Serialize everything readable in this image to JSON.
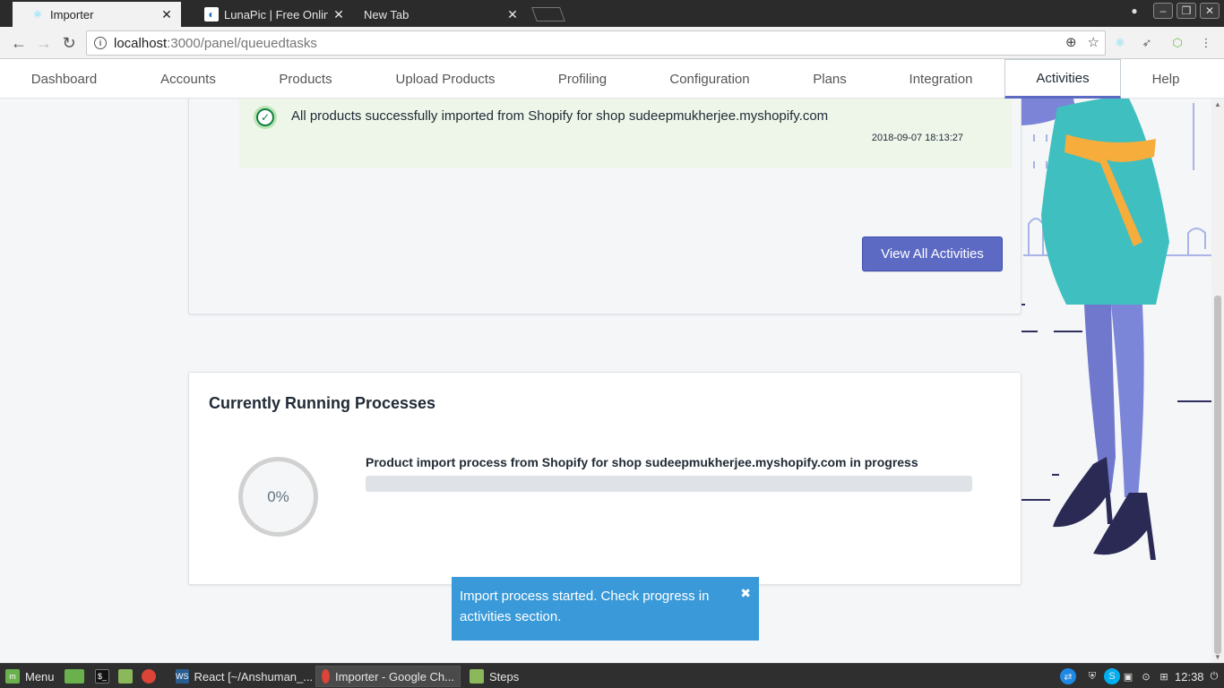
{
  "browser": {
    "tabs": [
      {
        "title": "Importer",
        "icon": "react-icon",
        "active": true
      },
      {
        "title": "LunaPic | Free Online Photo Editor",
        "icon": "lunapic-icon",
        "active": false
      },
      {
        "title": "New Tab",
        "icon": "",
        "active": false
      }
    ],
    "url_host": "localhost",
    "url_path": ":3000/panel/queuedtasks"
  },
  "nav": {
    "items": [
      {
        "label": "Dashboard"
      },
      {
        "label": "Accounts"
      },
      {
        "label": "Products"
      },
      {
        "label": "Upload Products"
      },
      {
        "label": "Profiling"
      },
      {
        "label": "Configuration"
      },
      {
        "label": "Plans"
      },
      {
        "label": "Integration"
      },
      {
        "label": "Activities"
      },
      {
        "label": "Help"
      }
    ],
    "active": "Activities"
  },
  "activity": {
    "message": "All products successfully imported from Shopify for shop sudeepmukherjee.myshopify.com",
    "timestamp": "2018-09-07 18:13:27",
    "view_all_label": "View All Activities"
  },
  "processes": {
    "title": "Currently Running Processes",
    "items": [
      {
        "percent_label": "0%",
        "progress": 0,
        "label": "Product import process from Shopify for shop sudeepmukherjee.myshopify.com in progress"
      }
    ]
  },
  "toast": {
    "message": "Import process started. Check progress in activities section.",
    "close_glyph": "✖"
  },
  "taskbar": {
    "menu_label": "Menu",
    "windows": [
      {
        "title": "React [~/Anshuman_..."
      },
      {
        "title": "Importer - Google Ch..."
      },
      {
        "title": "Steps"
      }
    ],
    "clock": "12:38"
  },
  "colors": {
    "accent": "#5c6ac4",
    "success_bg": "#eef6ea",
    "success_icon": "#108043",
    "toast_bg": "#3a9ad9"
  }
}
